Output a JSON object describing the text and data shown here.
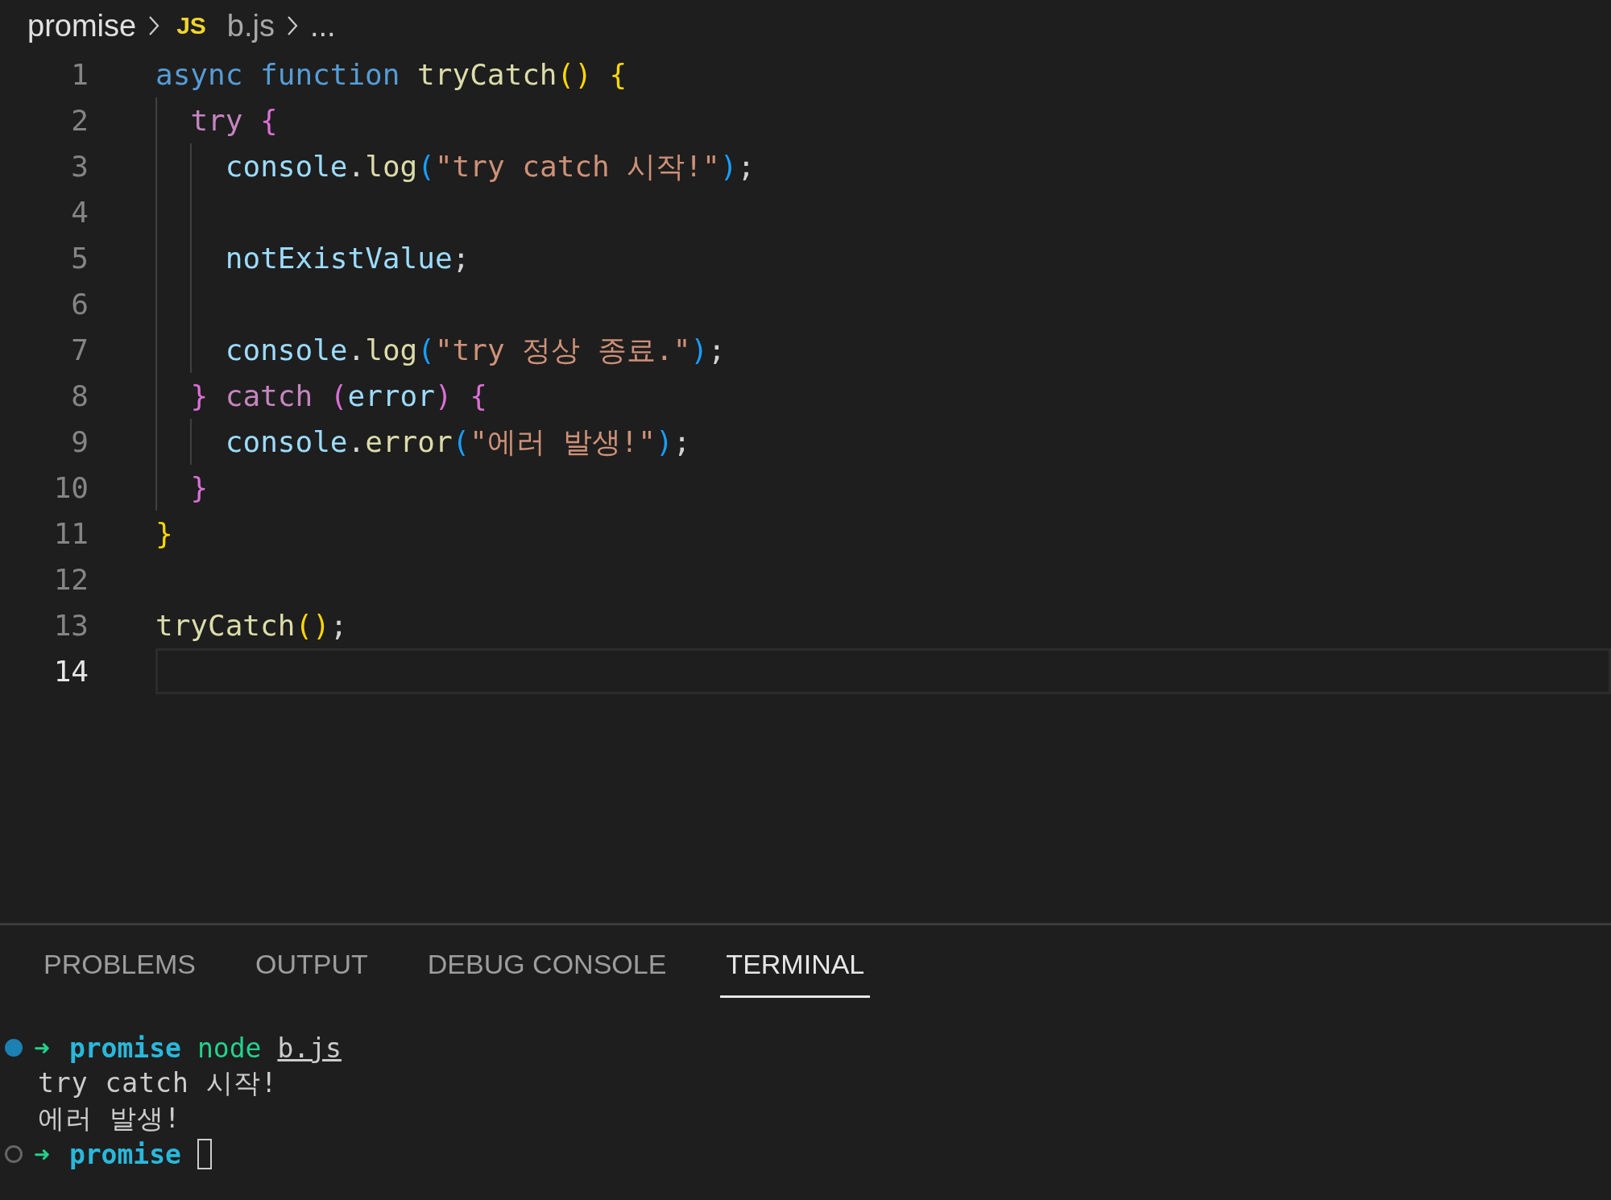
{
  "breadcrumb": {
    "folder": "promise",
    "file_icon": "JS",
    "file": "b.js",
    "more": "..."
  },
  "editor": {
    "lines": [
      {
        "number": "1",
        "current": false,
        "tokens": [
          {
            "t": "async",
            "kind": "storage"
          },
          {
            "t": "function",
            "kind": "storage",
            "gap": true
          },
          {
            "t": "tryCatch",
            "kind": "function",
            "gap": true
          },
          {
            "t": "()",
            "kind": "bracket1"
          },
          {
            "t": "{",
            "kind": "bracket1",
            "gap": true
          }
        ],
        "children": [
          {
            "number": "2",
            "current": false,
            "tokens": [
              {
                "t": "try",
                "kind": "control"
              },
              {
                "t": "{",
                "kind": "bracket2",
                "gap": true
              }
            ],
            "children": [
              {
                "number": "3",
                "current": false,
                "tokens": [
                  {
                    "t": "console",
                    "kind": "variable"
                  },
                  {
                    "t": ".",
                    "kind": "punct"
                  },
                  {
                    "t": "log",
                    "kind": "function"
                  },
                  {
                    "t": "(",
                    "kind": "bracket3"
                  },
                  {
                    "t": "\"try catch 시작!\"",
                    "kind": "string"
                  },
                  {
                    "t": ")",
                    "kind": "bracket3"
                  },
                  {
                    "t": ";",
                    "kind": "punct"
                  }
                ]
              },
              {
                "number": "4",
                "current": false
              },
              {
                "number": "5",
                "current": false,
                "tokens": [
                  {
                    "t": "notExistValue",
                    "kind": "variable"
                  },
                  {
                    "t": ";",
                    "kind": "punct"
                  }
                ]
              },
              {
                "number": "6",
                "current": false
              },
              {
                "number": "7",
                "current": false,
                "tokens": [
                  {
                    "t": "console",
                    "kind": "variable"
                  },
                  {
                    "t": ".",
                    "kind": "punct"
                  },
                  {
                    "t": "log",
                    "kind": "function"
                  },
                  {
                    "t": "(",
                    "kind": "bracket3"
                  },
                  {
                    "t": "\"try 정상 종료.\"",
                    "kind": "string"
                  },
                  {
                    "t": ")",
                    "kind": "bracket3"
                  },
                  {
                    "t": ";",
                    "kind": "punct"
                  }
                ]
              }
            ]
          },
          {
            "number": "8",
            "current": false,
            "tokens": [
              {
                "t": "}",
                "kind": "bracket2"
              },
              {
                "t": "catch",
                "kind": "control",
                "gap": true
              },
              {
                "t": "(",
                "kind": "bracket2",
                "gap": true
              },
              {
                "t": "error",
                "kind": "variable"
              },
              {
                "t": ")",
                "kind": "bracket2"
              },
              {
                "t": "{",
                "kind": "bracket2",
                "gap": true
              }
            ],
            "children": [
              {
                "number": "9",
                "current": false,
                "tokens": [
                  {
                    "t": "console",
                    "kind": "variable"
                  },
                  {
                    "t": ".",
                    "kind": "punct"
                  },
                  {
                    "t": "error",
                    "kind": "function"
                  },
                  {
                    "t": "(",
                    "kind": "bracket3"
                  },
                  {
                    "t": "\"에러 발생!\"",
                    "kind": "string"
                  },
                  {
                    "t": ")",
                    "kind": "bracket3"
                  },
                  {
                    "t": ";",
                    "kind": "punct"
                  }
                ]
              }
            ]
          },
          {
            "number": "10",
            "current": false,
            "tokens": [
              {
                "t": "}",
                "kind": "bracket2"
              }
            ]
          }
        ]
      },
      {
        "number": "11",
        "current": false,
        "tokens": [
          {
            "t": "}",
            "kind": "bracket1"
          }
        ]
      },
      {
        "number": "12",
        "current": false
      },
      {
        "number": "13",
        "current": false,
        "tokens": [
          {
            "t": "tryCatch",
            "kind": "function"
          },
          {
            "t": "()",
            "kind": "bracket1"
          },
          {
            "t": ";",
            "kind": "punct"
          }
        ]
      },
      {
        "number": "14",
        "current": true
      }
    ]
  },
  "panel": {
    "tabs": [
      {
        "label": "PROBLEMS",
        "selected": false
      },
      {
        "label": "OUTPUT",
        "selected": false
      },
      {
        "label": "DEBUG CONSOLE",
        "selected": false
      },
      {
        "label": "TERMINAL",
        "selected": true
      }
    ],
    "terminal": [
      {
        "kind": "command",
        "arrow": "➜",
        "dir": "promise",
        "command": "node",
        "arg": "b.js"
      },
      {
        "kind": "output",
        "text": "try catch 시작!"
      },
      {
        "kind": "output",
        "text": "에러 발생!"
      },
      {
        "kind": "prompt",
        "arrow": "➜",
        "dir": "promise"
      }
    ]
  }
}
